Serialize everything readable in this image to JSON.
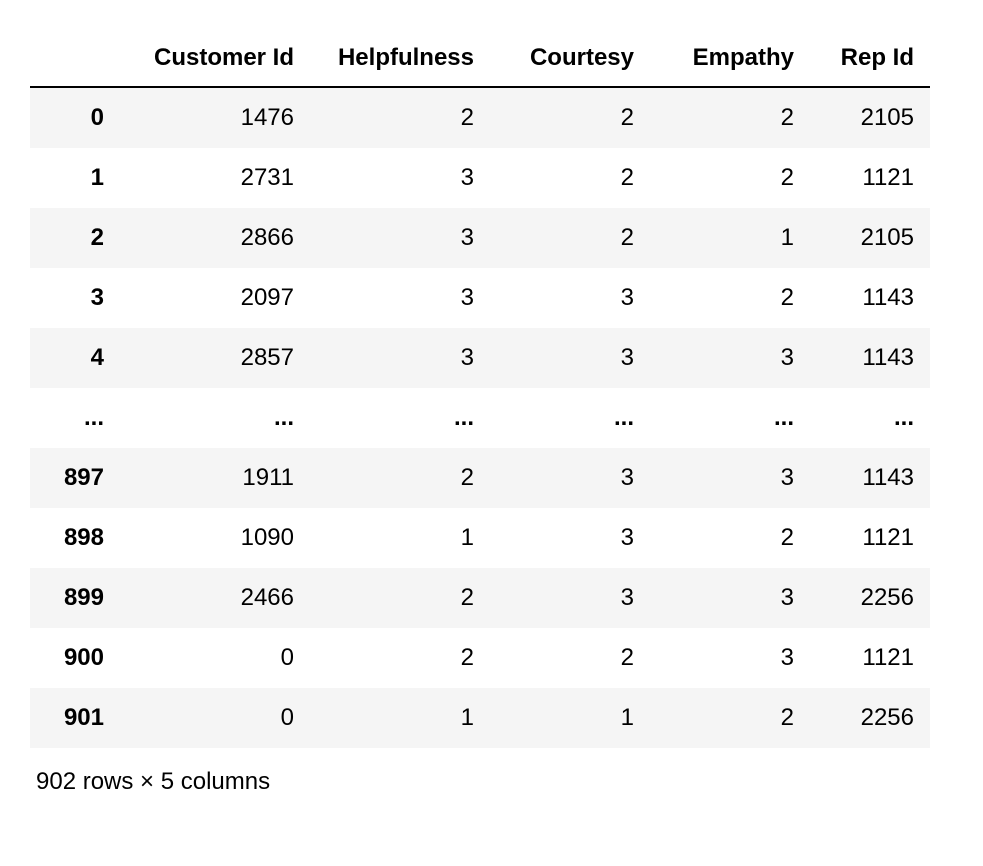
{
  "chart_data": {
    "type": "table",
    "columns": [
      "Customer Id",
      "Helpfulness",
      "Courtesy",
      "Empathy",
      "Rep Id"
    ],
    "index": [
      "0",
      "1",
      "2",
      "3",
      "4",
      "...",
      "897",
      "898",
      "899",
      "900",
      "901"
    ],
    "rows": [
      [
        "1476",
        "2",
        "2",
        "2",
        "2105"
      ],
      [
        "2731",
        "3",
        "2",
        "2",
        "1121"
      ],
      [
        "2866",
        "3",
        "2",
        "1",
        "2105"
      ],
      [
        "2097",
        "3",
        "3",
        "2",
        "1143"
      ],
      [
        "2857",
        "3",
        "3",
        "3",
        "1143"
      ],
      [
        "...",
        "...",
        "...",
        "...",
        "..."
      ],
      [
        "1911",
        "2",
        "3",
        "3",
        "1143"
      ],
      [
        "1090",
        "1",
        "3",
        "2",
        "1121"
      ],
      [
        "2466",
        "2",
        "3",
        "3",
        "2256"
      ],
      [
        "0",
        "2",
        "2",
        "3",
        "1121"
      ],
      [
        "0",
        "1",
        "1",
        "2",
        "2256"
      ]
    ],
    "summary": "902 rows × 5 columns"
  },
  "table": {
    "headers": {
      "blank": "",
      "customer_id": "Customer Id",
      "helpfulness": "Helpfulness",
      "courtesy": "Courtesy",
      "empathy": "Empathy",
      "rep_id": "Rep Id"
    },
    "rows": [
      {
        "index": "0",
        "customer_id": "1476",
        "helpfulness": "2",
        "courtesy": "2",
        "empathy": "2",
        "rep_id": "2105",
        "ellipsis": false
      },
      {
        "index": "1",
        "customer_id": "2731",
        "helpfulness": "3",
        "courtesy": "2",
        "empathy": "2",
        "rep_id": "1121",
        "ellipsis": false
      },
      {
        "index": "2",
        "customer_id": "2866",
        "helpfulness": "3",
        "courtesy": "2",
        "empathy": "1",
        "rep_id": "2105",
        "ellipsis": false
      },
      {
        "index": "3",
        "customer_id": "2097",
        "helpfulness": "3",
        "courtesy": "3",
        "empathy": "2",
        "rep_id": "1143",
        "ellipsis": false
      },
      {
        "index": "4",
        "customer_id": "2857",
        "helpfulness": "3",
        "courtesy": "3",
        "empathy": "3",
        "rep_id": "1143",
        "ellipsis": false
      },
      {
        "index": "...",
        "customer_id": "...",
        "helpfulness": "...",
        "courtesy": "...",
        "empathy": "...",
        "rep_id": "...",
        "ellipsis": true
      },
      {
        "index": "897",
        "customer_id": "1911",
        "helpfulness": "2",
        "courtesy": "3",
        "empathy": "3",
        "rep_id": "1143",
        "ellipsis": false
      },
      {
        "index": "898",
        "customer_id": "1090",
        "helpfulness": "1",
        "courtesy": "3",
        "empathy": "2",
        "rep_id": "1121",
        "ellipsis": false
      },
      {
        "index": "899",
        "customer_id": "2466",
        "helpfulness": "2",
        "courtesy": "3",
        "empathy": "3",
        "rep_id": "2256",
        "ellipsis": false
      },
      {
        "index": "900",
        "customer_id": "0",
        "helpfulness": "2",
        "courtesy": "2",
        "empathy": "3",
        "rep_id": "1121",
        "ellipsis": false
      },
      {
        "index": "901",
        "customer_id": "0",
        "helpfulness": "1",
        "courtesy": "1",
        "empathy": "2",
        "rep_id": "2256",
        "ellipsis": false
      }
    ],
    "footer": "902 rows × 5 columns"
  }
}
